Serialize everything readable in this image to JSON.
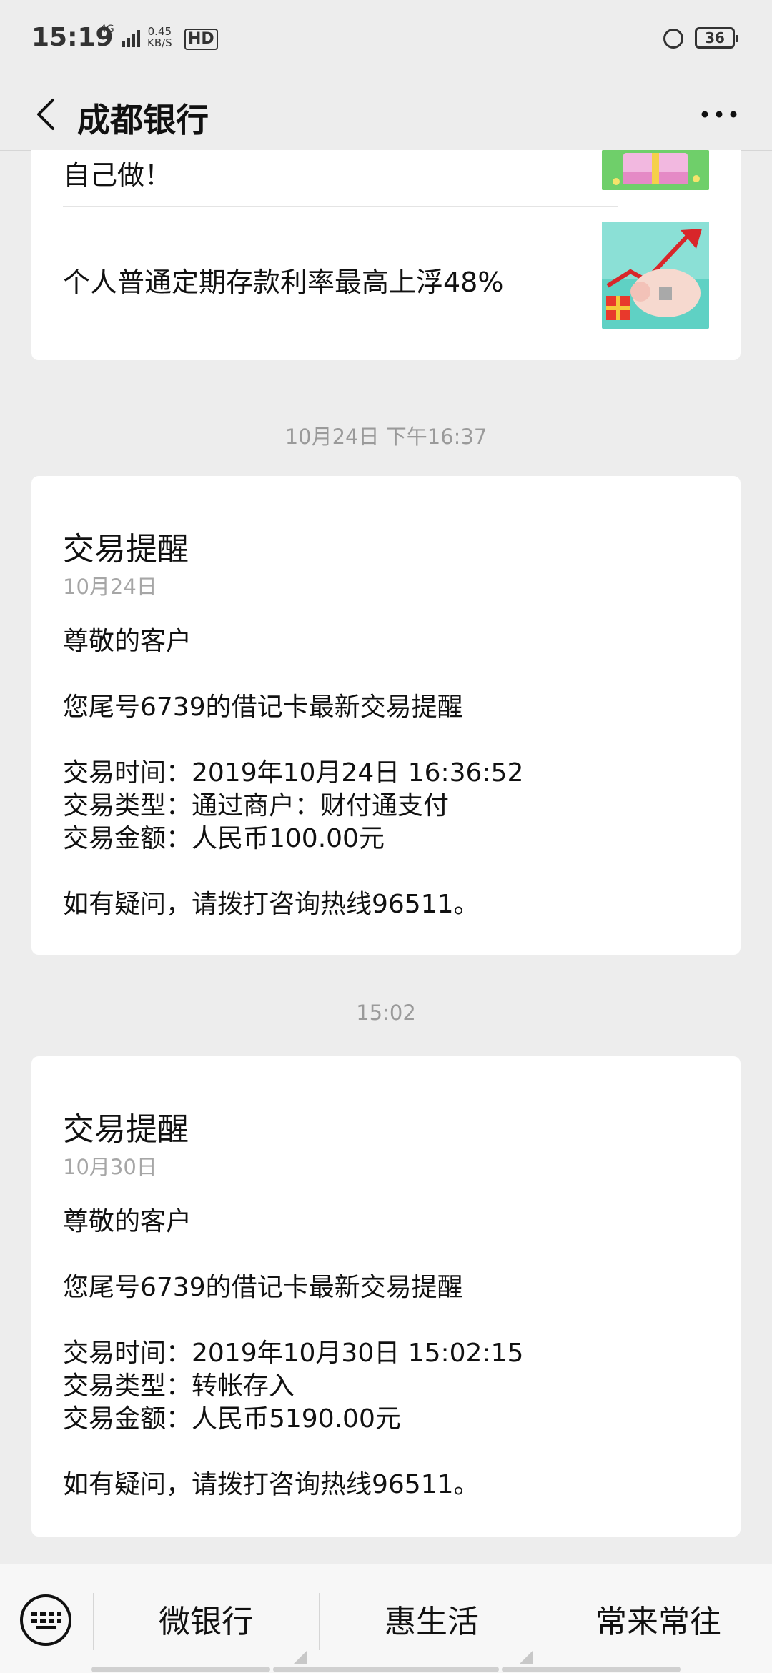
{
  "status_bar": {
    "time": "15:19",
    "network": "4G",
    "speed_value": "0.45",
    "speed_unit": "KB/S",
    "hd": "HD",
    "battery": "36"
  },
  "header": {
    "title": "成都银行"
  },
  "articles": [
    {
      "title": "自己做！"
    },
    {
      "title": "个人普通定期存款利率最高上浮48%"
    }
  ],
  "messages": [
    {
      "timestamp": "10月24日 下午16:37",
      "title": "交易提醒",
      "date": "10月24日",
      "greeting": "尊敬的客户",
      "intro": "您尾号6739的借记卡最新交易提醒",
      "time_line": "交易时间：2019年10月24日 16:36:52",
      "type_line": "交易类型：通过商户：财付通支付",
      "amount_line": "交易金额：人民币100.00元",
      "footer": "如有疑问，请拨打咨询热线96511。"
    },
    {
      "timestamp": "15:02",
      "title": "交易提醒",
      "date": "10月30日",
      "greeting": "尊敬的客户",
      "intro": "您尾号6739的借记卡最新交易提醒",
      "time_line": "交易时间：2019年10月30日 15:02:15",
      "type_line": "交易类型：转帐存入",
      "amount_line": "交易金额：人民币5190.00元",
      "footer": "如有疑问，请拨打咨询热线96511。"
    }
  ],
  "bottom_menu": {
    "items": [
      {
        "label": "微银行"
      },
      {
        "label": "惠生活"
      },
      {
        "label": "常来常往"
      }
    ]
  }
}
